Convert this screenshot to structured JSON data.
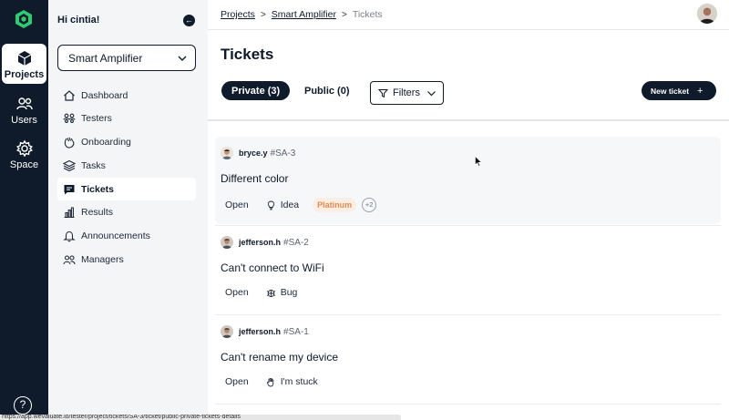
{
  "rail": {
    "items": [
      {
        "label": "Projects",
        "icon": "cube-icon",
        "active": true
      },
      {
        "label": "Users",
        "icon": "users-icon",
        "active": false
      },
      {
        "label": "Space",
        "icon": "gear-icon",
        "active": false
      }
    ],
    "help_label": "?",
    "colors": {
      "background": "#0f1a2a",
      "logo": "#2ecc71"
    }
  },
  "sidebar": {
    "greeting": "Hi cintia!",
    "collapse_icon": "arrow-left-icon",
    "project_select": {
      "value": "Smart Amplifier"
    },
    "items": [
      {
        "label": "Dashboard",
        "icon": "home-icon"
      },
      {
        "label": "Testers",
        "icon": "people-icon"
      },
      {
        "label": "Onboarding",
        "icon": "hand-wave-icon"
      },
      {
        "label": "Tasks",
        "icon": "layers-icon"
      },
      {
        "label": "Tickets",
        "icon": "chat-icon",
        "active": true
      },
      {
        "label": "Results",
        "icon": "bar-chart-icon"
      },
      {
        "label": "Announcements",
        "icon": "bell-icon"
      },
      {
        "label": "Managers",
        "icon": "managers-icon"
      }
    ]
  },
  "header": {
    "breadcrumb": [
      "Projects",
      "Smart Amplifier",
      "Tickets"
    ]
  },
  "main": {
    "title": "Tickets",
    "tabs": [
      {
        "label": "Private (3)",
        "active": true
      },
      {
        "label": "Public (0)",
        "active": false
      }
    ],
    "filters_label": "Filters",
    "new_ticket_label": "New ticket",
    "new_ticket_plus": "+",
    "tickets": [
      {
        "user": "bryce.y",
        "id": "#SA-3",
        "title": "Different color",
        "status": "Open",
        "type": "Idea",
        "type_icon": "lightbulb-icon",
        "badge": "Platinum",
        "more": "+2"
      },
      {
        "user": "jefferson.h",
        "id": "#SA-2",
        "title": "Can't connect to WiFi",
        "status": "Open",
        "type": "Bug",
        "type_icon": "bug-icon"
      },
      {
        "user": "jefferson.h",
        "id": "#SA-1",
        "title": "Can't rename my device",
        "status": "Open",
        "type": "I'm stuck",
        "type_icon": "hand-icon"
      }
    ]
  },
  "statusbar": {
    "text": "https://app.wevaluate.io/tester/project/tickets/SA-3/ticket/public-private-tickets-details"
  },
  "colors": {
    "accent": "#0f1a2a",
    "platinum_bg": "#fbeee4",
    "platinum_text": "#e5894d"
  }
}
